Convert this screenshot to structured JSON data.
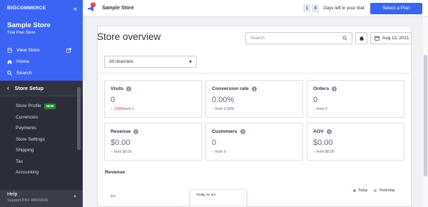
{
  "sidebar": {
    "logo_prefix": "BIG",
    "logo_suffix": "COMMERCE",
    "collapse_glyph": "«",
    "store_name": "Sample Store",
    "plan": "Trial Plan Store",
    "links": [
      {
        "label": "View Store",
        "icon": "store-icon"
      },
      {
        "label": "Home",
        "icon": "home-icon"
      },
      {
        "label": "Search",
        "icon": "search-icon"
      }
    ],
    "section": "Store Setup",
    "menu": [
      {
        "label": "Store Profile",
        "badge": "NEW"
      },
      {
        "label": "Currencies"
      },
      {
        "label": "Payments"
      },
      {
        "label": "Store Settings"
      },
      {
        "label": "Shipping"
      },
      {
        "label": "Tax"
      },
      {
        "label": "Accounting"
      }
    ],
    "help_title": "Help",
    "help_pin": "Support PIN: 48605846"
  },
  "topbar": {
    "notification_count": "1",
    "store_name": "Sample Store",
    "trial_day_1": "1",
    "trial_day_2": "4",
    "trial_text": "Days left in your trial.",
    "plan_button": "Select a Plan"
  },
  "overview": {
    "title": "Store overview",
    "search_placeholder": "Search",
    "date": "Aug 12, 2021",
    "channel_select": "All channels"
  },
  "cards": [
    {
      "title": "Visits",
      "value": "0",
      "delta_pct": "100%",
      "delta_text": " from 1",
      "negative": true
    },
    {
      "title": "Conversion rate",
      "value": "0.00%",
      "delta_text": "-- from 0.00%"
    },
    {
      "title": "Orders",
      "value": "0",
      "delta_text": "-- from 0"
    },
    {
      "title": "Revenue",
      "value": "$0.00",
      "delta_text": "-- from $0.00"
    },
    {
      "title": "Customers",
      "value": "0",
      "delta_text": "-- from 0"
    },
    {
      "title": "AOV",
      "value": "$0.00",
      "delta_text": "-- from $0.00"
    }
  ],
  "revenue": {
    "title": "Revenue",
    "y_tick": "$1k",
    "tooltip_title": "Today 11 am",
    "legend": [
      {
        "label": "Today",
        "color": "#a884e8"
      },
      {
        "label": "Yesterday",
        "color": "#f0a869"
      }
    ]
  },
  "colors": {
    "brand": "#3c64f4",
    "sidebar": "#2b2d38",
    "danger": "#db3643",
    "success": "#208831"
  }
}
